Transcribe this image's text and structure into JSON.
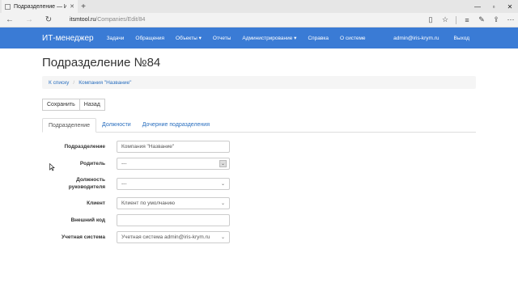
{
  "browser": {
    "tab_title": "Подразделение — ИТ-",
    "url_host": "itsmtool.ru",
    "url_path": "/Companies/Edit/84"
  },
  "nav": {
    "brand": "ИТ-менеджер",
    "items": [
      "Задачи",
      "Обращения",
      "Объекты ▾",
      "Отчеты",
      "Администрирование ▾",
      "Справка",
      "О системе"
    ],
    "user": "admin@iris-krym.ru",
    "logout": "Выход"
  },
  "page": {
    "title": "Подразделение №84"
  },
  "breadcrumb": {
    "back": "К списку",
    "current": "Компания \"Название\""
  },
  "actions": {
    "save": "Сохранить",
    "back": "Назад"
  },
  "tabs": [
    "Подразделение",
    "Должности",
    "Дочерние подразделения"
  ],
  "form": {
    "division_label": "Подразделение",
    "division_value": "Компания \"Название\"",
    "parent_label": "Родитель",
    "parent_value": "---",
    "head_position_label": "Должность руководителя",
    "head_position_value": "---",
    "client_label": "Клиент",
    "client_value": "Клиент по умолчанию",
    "external_code_label": "Внешний код",
    "external_code_value": "",
    "system_label": "Учетная система",
    "system_value": "Учетная система admin@iris-krym.ru"
  },
  "colors": {
    "navbar": "#3a7bd5",
    "link": "#2a6fbf"
  }
}
